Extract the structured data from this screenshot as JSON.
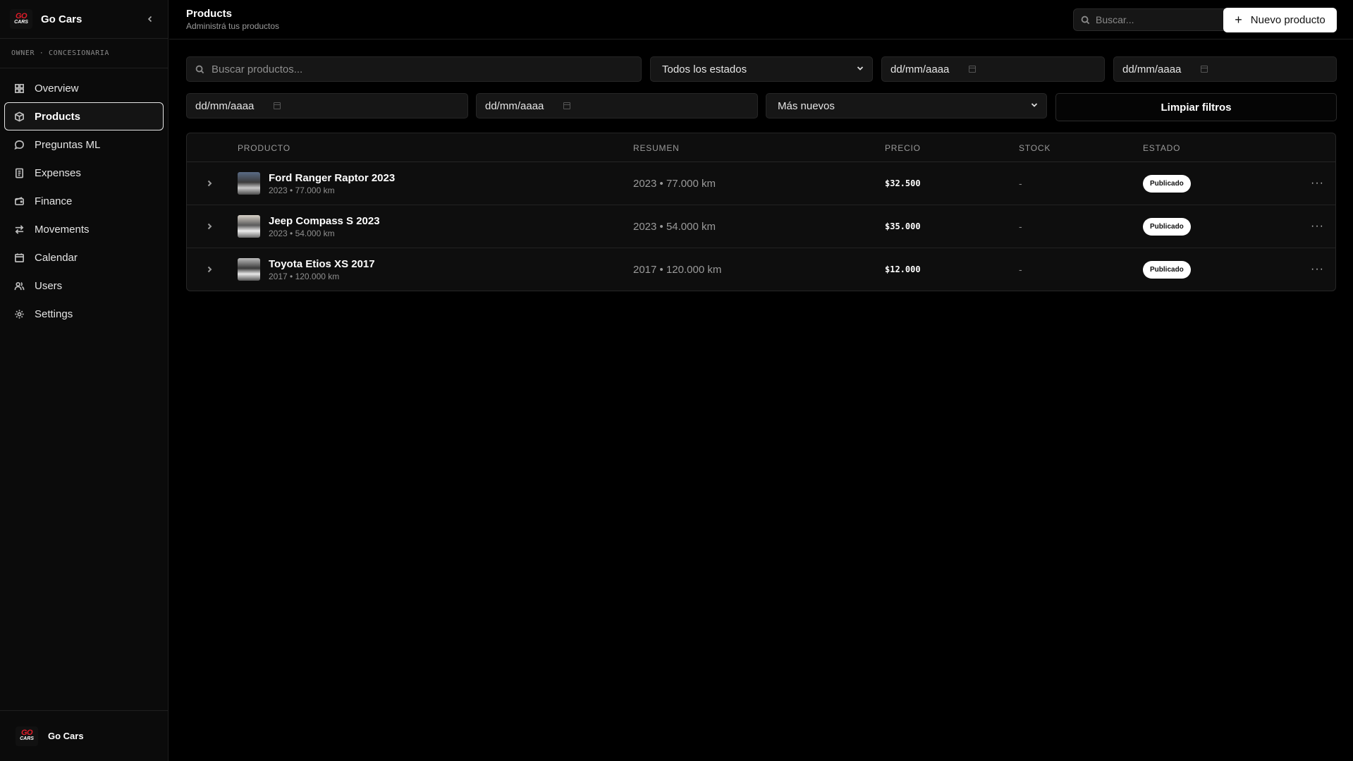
{
  "app": {
    "name": "Go Cars",
    "role": "OWNER · CONCESIONARIA",
    "logo_top": "GO",
    "logo_bottom": "CARS"
  },
  "sidebar": {
    "items": [
      {
        "label": "Overview",
        "icon": "grid-icon"
      },
      {
        "label": "Products",
        "icon": "package-icon",
        "active": true
      },
      {
        "label": "Preguntas ML",
        "icon": "chat-icon"
      },
      {
        "label": "Expenses",
        "icon": "receipt-icon"
      },
      {
        "label": "Finance",
        "icon": "wallet-icon"
      },
      {
        "label": "Movements",
        "icon": "arrows-icon"
      },
      {
        "label": "Calendar",
        "icon": "calendar-icon"
      },
      {
        "label": "Users",
        "icon": "users-icon"
      },
      {
        "label": "Settings",
        "icon": "gear-icon"
      }
    ],
    "footer_name": "Go Cars"
  },
  "header": {
    "title": "Products",
    "subtitle": "Administrá tus productos",
    "search_placeholder": "Buscar...",
    "new_button": "Nuevo producto"
  },
  "filters": {
    "search_placeholder": "Buscar productos...",
    "status_value": "Todos los estados",
    "date_from_1": "dd/mm/aaaa",
    "date_to_1": "dd/mm/aaaa",
    "date_from_2": "dd/mm/aaaa",
    "date_to_2": "dd/mm/aaaa",
    "sort_value": "Más nuevos",
    "clear_button": "Limpiar filtros"
  },
  "table": {
    "columns": [
      "PRODUCTO",
      "RESUMEN",
      "PRECIO",
      "STOCK",
      "ESTADO"
    ],
    "rows": [
      {
        "name": "Ford Ranger Raptor 2023",
        "meta": "2023 • 77.000 km",
        "summary": "2023 • 77.000 km",
        "price": "$32.500",
        "stock": "-",
        "status": "Publicado"
      },
      {
        "name": "Jeep Compass S 2023",
        "meta": "2023 • 54.000 km",
        "summary": "2023 • 54.000 km",
        "price": "$35.000",
        "stock": "-",
        "status": "Publicado"
      },
      {
        "name": "Toyota Etios XS 2017",
        "meta": "2017 • 120.000 km",
        "summary": "2017 • 120.000 km",
        "price": "$12.000",
        "stock": "-",
        "status": "Publicado"
      }
    ]
  }
}
